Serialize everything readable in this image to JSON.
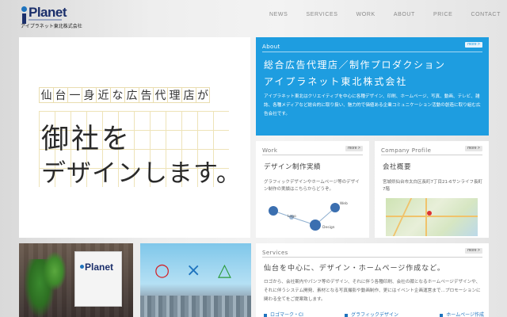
{
  "brand": {
    "logo_text": "Planet",
    "logo_sub": "アイプラネット東北株式会社"
  },
  "nav": [
    "NEWS",
    "SERVICES",
    "WORK",
    "ABOUT",
    "PRICE",
    "CONTACT"
  ],
  "hero": {
    "line1_chars": [
      "仙",
      "台",
      "一",
      "身",
      "近",
      "な",
      "広",
      "告",
      "代",
      "理",
      "店",
      "が"
    ],
    "line2": "御社を",
    "line3": "デザインします。"
  },
  "about": {
    "label": "About",
    "more": "more >",
    "title1": "総合広告代理店／制作プロダクション",
    "title2": "アイプラネット東北株式会社",
    "body": "アイプラネット東北はクリエイティブを中心に各種デザイン、印刷、ホームページ、写真、動画、テレビ、雑誌、各種メディアなど総合的に取り扱い、魅力的で価値ある企業コミュニケーション活動の創造に取り組む広告会社です。"
  },
  "work": {
    "label": "Work",
    "more": "more >",
    "title": "デザイン制作実績",
    "body": "グラフィックデザインやホームページ等のデザイン制作の実績はこちらからどうぞ。",
    "nodes": [
      "Logo",
      "Web",
      "Design"
    ]
  },
  "company": {
    "label": "Company Profile",
    "more": "more >",
    "title": "会社概要",
    "body": "宮城県仙台市太白区長町7丁目21-6サンライフ長町7階"
  },
  "services": {
    "label": "Services",
    "more": "more >",
    "title": "仙台を中心に、デザイン・ホームページ作成など。",
    "body": "ロゴから、会社案内やパンフ等のデザイン、それに伴う各種印刷、会社の顔となるホームページデザインや、それに伴うシステム開発、素材となる写真撮影や動画制作、更にはイベント企画運営まで…プロモーションに関わる全てをご提案致します。",
    "links": [
      "ロゴマーク・CI",
      "グラフィックデザイン",
      "ホームページ作成"
    ]
  },
  "photo2": {
    "symbols": [
      "○",
      "×",
      "△"
    ]
  },
  "colors": {
    "accent": "#1e9de0",
    "brand": "#1b2f6b"
  }
}
